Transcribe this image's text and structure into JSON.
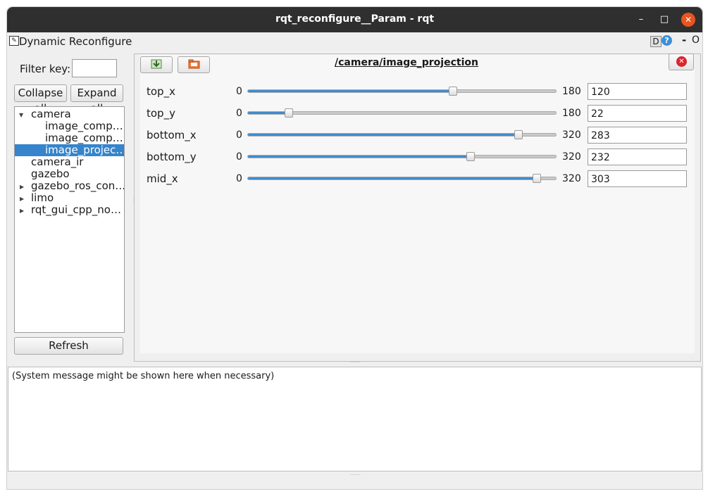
{
  "window": {
    "title": "rqt_reconfigure__Param - rqt",
    "controls": {
      "minimize": "–",
      "maximize": "□",
      "close": "✕"
    }
  },
  "dock": {
    "title": "Dynamic Reconfigure",
    "badge": "D",
    "help": "?",
    "minus": "-",
    "float": "O"
  },
  "sidebar": {
    "filter_label": "Filter key:",
    "filter_value": "",
    "collapse_label": "Collapse all",
    "expand_label": "Expand all",
    "refresh_label": "Refresh",
    "tree": [
      {
        "label": "camera",
        "expanded": true
      },
      {
        "label": "image_comp…"
      },
      {
        "label": "image_comp…"
      },
      {
        "label": "image_projec…",
        "selected": true
      },
      {
        "label": "camera_ir"
      },
      {
        "label": "gazebo"
      },
      {
        "label": "gazebo_ros_con…",
        "expandable": true
      },
      {
        "label": "limo",
        "expandable": true
      },
      {
        "label": "rqt_gui_cpp_no…",
        "expandable": true
      }
    ]
  },
  "param_panel": {
    "node_title": "/camera/image_projection",
    "params": [
      {
        "name": "top_x",
        "min": "0",
        "max": "180",
        "value": "120"
      },
      {
        "name": "top_y",
        "min": "0",
        "max": "180",
        "value": "22"
      },
      {
        "name": "bottom_x",
        "min": "0",
        "max": "320",
        "value": "283"
      },
      {
        "name": "bottom_y",
        "min": "0",
        "max": "320",
        "value": "232"
      },
      {
        "name": "mid_x",
        "min": "0",
        "max": "320",
        "value": "303"
      }
    ]
  },
  "messages": {
    "text": "(System message might be shown here when necessary)"
  },
  "colors": {
    "accent": "#3584cc",
    "title_bar": "#2f2f2f",
    "close": "#e95420"
  }
}
